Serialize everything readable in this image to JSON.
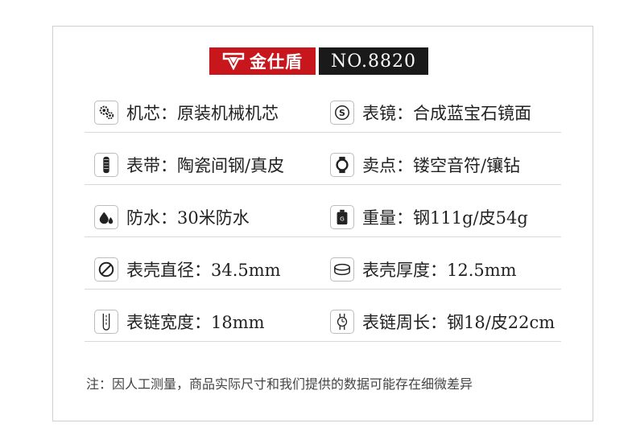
{
  "brand": {
    "logo_text": "金仕盾",
    "model": "NO.8820",
    "logo_color": "#c8161d"
  },
  "specs": [
    {
      "left": {
        "icon": "gears-icon",
        "text": "机芯：原装机械机芯"
      },
      "right": {
        "icon": "s-circle-icon",
        "text": "表镜：合成蓝宝石镜面"
      }
    },
    {
      "left": {
        "icon": "strap-icon",
        "text": "表带：陶瓷间钢/真皮"
      },
      "right": {
        "icon": "watch-case-icon",
        "text": "卖点：镂空音符/镶钻"
      }
    },
    {
      "left": {
        "icon": "water-drops-icon",
        "text": "防水：30米防水"
      },
      "right": {
        "icon": "weight-icon",
        "text": "重量：钢111g/皮54g"
      }
    },
    {
      "left": {
        "icon": "diameter-icon",
        "text": "表壳直径：34.5mm"
      },
      "right": {
        "icon": "thickness-icon",
        "text": "表壳厚度：12.5mm"
      }
    },
    {
      "left": {
        "icon": "strap-width-icon",
        "text": "表链宽度：18mm"
      },
      "right": {
        "icon": "strap-length-icon",
        "text": "表链周长：钢18/皮22cm"
      }
    }
  ],
  "note": "注：因人工测量，商品实际尺寸和我们提供的数据可能存在细微差异"
}
